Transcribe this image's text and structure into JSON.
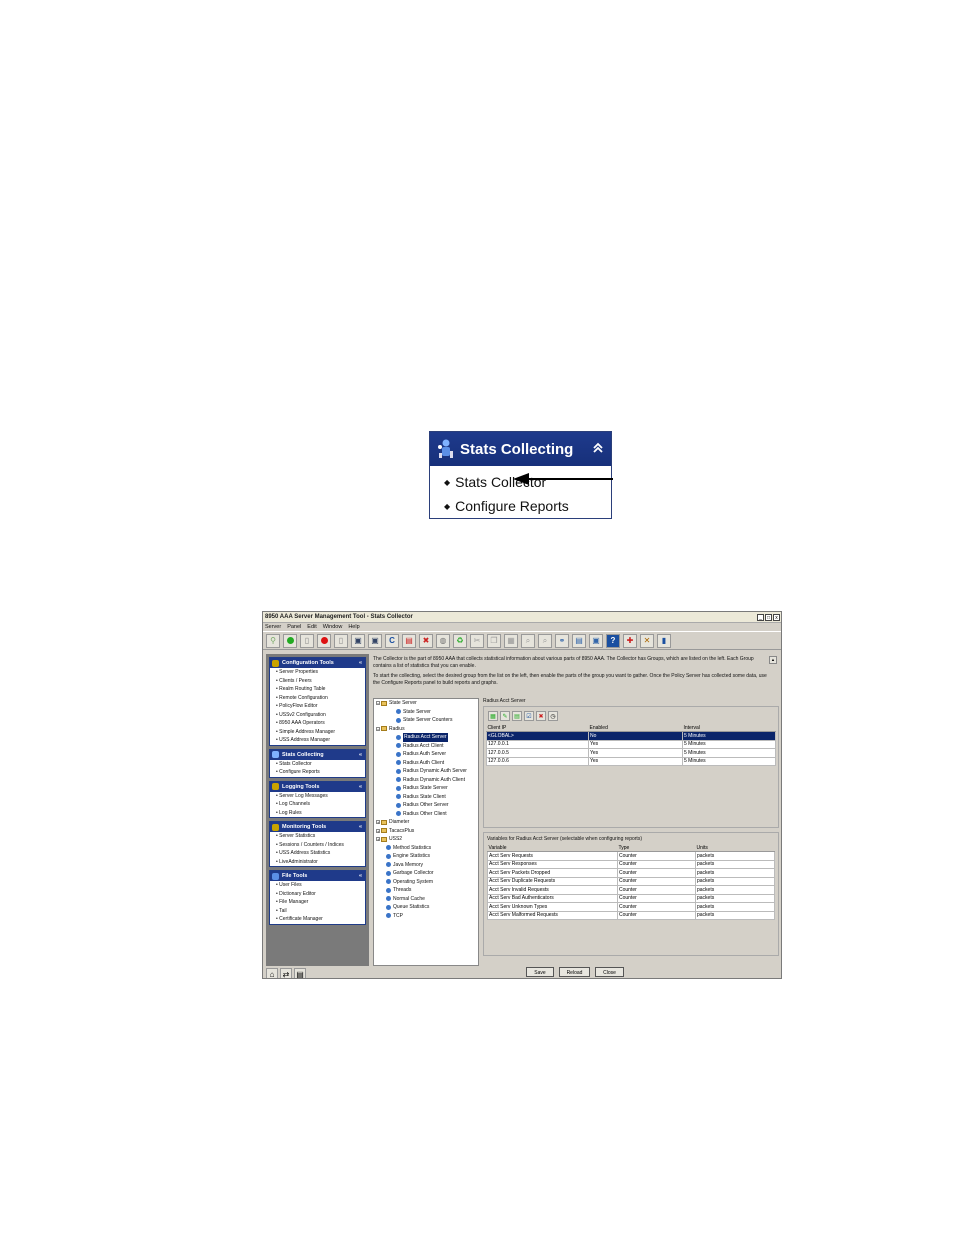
{
  "callout": {
    "title": "Stats Collecting",
    "collapse_glyph": "«",
    "items": [
      "Stats Collector",
      "Configure Reports"
    ]
  },
  "window": {
    "title": "8950 AAA Server Management Tool - Stats Collector",
    "controls": [
      "_",
      "□",
      "x"
    ],
    "menu": [
      "Server",
      "Panel",
      "Edit",
      "Window",
      "Help"
    ]
  },
  "nav": {
    "panels": [
      {
        "title": "Configuration Tools",
        "items": [
          "Server Properties",
          "Clients / Peers",
          "Realm Routing Table",
          "Remote Configuration",
          "PolicyFlow Editor",
          "USSv2 Configuration",
          "8950 AAA Operators",
          "Simple Address Manager",
          "USS Address Manager"
        ]
      },
      {
        "title": "Stats Collecting",
        "items": [
          "Stats Collector",
          "Configure Reports"
        ]
      },
      {
        "title": "Logging Tools",
        "items": [
          "Server Log Messages",
          "Log Channels",
          "Log Rules"
        ]
      },
      {
        "title": "Monitoring Tools",
        "items": [
          "Server Statistics",
          "Sessions / Counters / Indices",
          "USS Address Statistics",
          "LiveAdministrator"
        ]
      },
      {
        "title": "File Tools",
        "items": [
          "User Files",
          "Dictionary Editor",
          "File Manager",
          "Tail",
          "Certificate Manager"
        ]
      }
    ]
  },
  "description": {
    "p1": "The Collector is the part of 8950 AAA that collects statistical information about various parts of 8950 AAA. The Collector has Groups, which are listed on the left. Each Group contains a list of statistics that you can enable.",
    "p2": "To start the collecting, select the desired group from the list on the left, then enable the parts of the group you want to gather. Once the Policy Server has collected some data, use the Configure Reports panel to build reports and graphs."
  },
  "tree": [
    {
      "label": "State Server",
      "level": 0,
      "type": "folder",
      "toggle": "−"
    },
    {
      "label": "State Server",
      "level": 1,
      "type": "leaf"
    },
    {
      "label": "State Server Counters",
      "level": 1,
      "type": "leaf"
    },
    {
      "label": "Radius",
      "level": 0,
      "type": "folder",
      "toggle": "−"
    },
    {
      "label": "Radius Acct Server",
      "level": 1,
      "type": "leaf",
      "selected": true
    },
    {
      "label": "Radius Acct Client",
      "level": 1,
      "type": "leaf"
    },
    {
      "label": "Radius Auth Server",
      "level": 1,
      "type": "leaf"
    },
    {
      "label": "Radius Auth Client",
      "level": 1,
      "type": "leaf"
    },
    {
      "label": "Radius Dynamic Auth Server",
      "level": 1,
      "type": "leaf"
    },
    {
      "label": "Radius Dynamic Auth Client",
      "level": 1,
      "type": "leaf"
    },
    {
      "label": "Radius State Server",
      "level": 1,
      "type": "leaf"
    },
    {
      "label": "Radius State Client",
      "level": 1,
      "type": "leaf"
    },
    {
      "label": "Radius Other Server",
      "level": 1,
      "type": "leaf"
    },
    {
      "label": "Radius Other Client",
      "level": 1,
      "type": "leaf"
    },
    {
      "label": "Diameter",
      "level": 0,
      "type": "folder",
      "toggle": "+"
    },
    {
      "label": "TacacsPlus",
      "level": 0,
      "type": "folder",
      "toggle": "+"
    },
    {
      "label": "USS2",
      "level": 0,
      "type": "folder",
      "toggle": "+"
    },
    {
      "label": "Method Statistics",
      "level": 0,
      "type": "leaf"
    },
    {
      "label": "Engine Statistics",
      "level": 0,
      "type": "leaf"
    },
    {
      "label": "Java Memory",
      "level": 0,
      "type": "leaf"
    },
    {
      "label": "Garbage Collector",
      "level": 0,
      "type": "leaf"
    },
    {
      "label": "Operating System",
      "level": 0,
      "type": "leaf"
    },
    {
      "label": "Threads",
      "level": 0,
      "type": "leaf"
    },
    {
      "label": "Normal Cache",
      "level": 0,
      "type": "leaf"
    },
    {
      "label": "Queue Statistics",
      "level": 0,
      "type": "leaf"
    },
    {
      "label": "TCP",
      "level": 0,
      "type": "leaf"
    }
  ],
  "group": {
    "title": "Radius Acct Server",
    "clients": {
      "headers": [
        "Client IP",
        "Enabled",
        "Interval"
      ],
      "rows": [
        [
          "<GLOBAL>",
          "No",
          "5 Minutes"
        ],
        [
          "127.0.0.1",
          "Yes",
          "5 Minutes"
        ],
        [
          "127.0.0.5",
          "Yes",
          "5 Minutes"
        ],
        [
          "127.0.0.6",
          "Yes",
          "5 Minutes"
        ]
      ]
    },
    "variables_title": "Variables for Radius Acct Server (selectable when configuring reports)",
    "variables": {
      "headers": [
        "Variable",
        "Type",
        "Units"
      ],
      "rows": [
        [
          "Acct Serv Requests",
          "Counter",
          "packets"
        ],
        [
          "Acct Serv Responses",
          "Counter",
          "packets"
        ],
        [
          "Acct Serv Packets Dropped",
          "Counter",
          "packets"
        ],
        [
          "Acct Serv Duplicate Requests",
          "Counter",
          "packets"
        ],
        [
          "Acct Serv Invalid Requests",
          "Counter",
          "packets"
        ],
        [
          "Acct Serv Bad Authenticators",
          "Counter",
          "packets"
        ],
        [
          "Acct Serv Unknown Types",
          "Counter",
          "packets"
        ],
        [
          "Acct Serv Malformed Requests",
          "Counter",
          "packets"
        ]
      ]
    }
  },
  "buttons": {
    "save": "Save",
    "reload": "Reload",
    "close": "Close"
  },
  "colors": {
    "panel_header": "#1f3a8a",
    "selection": "#0a246a",
    "chrome": "#d4d0c8"
  }
}
